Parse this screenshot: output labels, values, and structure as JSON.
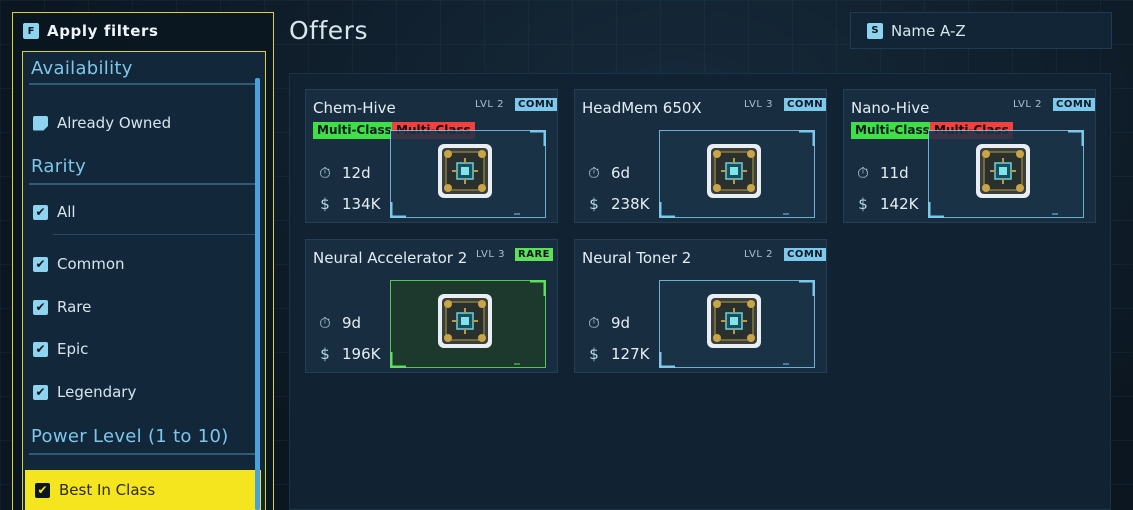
{
  "sidebar": {
    "key": "F",
    "title": "Apply filters",
    "sections": {
      "availability": "Availability",
      "rarity": "Rarity",
      "power": "Power Level (1 to 10)"
    },
    "items": {
      "owned": "Already Owned",
      "all": "All",
      "common": "Common",
      "rare": "Rare",
      "epic": "Epic",
      "legendary": "Legendary",
      "best": "Best In Class"
    },
    "check_glyph": "✔"
  },
  "header": {
    "title": "Offers",
    "sort_key": "S",
    "sort_label": "Name A-Z"
  },
  "colors": {
    "accent_yellow": "#f5e51e",
    "comn": "#7cc9ec",
    "rare": "#5fe05a",
    "tag_green": "#3ee046",
    "tag_red": "#f04040"
  },
  "icons": {
    "time": "stopwatch-icon",
    "price": "dollar-icon",
    "item": "chip-icon"
  },
  "cards": [
    {
      "name": "Chem-Hive",
      "level": "LVL 2",
      "rarity": "COMN",
      "tags": [
        "Multi-Class",
        "Multi-Class"
      ],
      "time": "12d",
      "price": "134K"
    },
    {
      "name": "HeadMem 650X",
      "level": "LVL 3",
      "rarity": "COMN",
      "tags": [],
      "time": "6d",
      "price": "238K"
    },
    {
      "name": "Nano-Hive",
      "level": "LVL 2",
      "rarity": "COMN",
      "tags": [
        "Multi-Class",
        "Multi-Class"
      ],
      "time": "11d",
      "price": "142K"
    },
    {
      "name": "Neural Accelerator 2",
      "level": "LVL 3",
      "rarity": "RARE",
      "tags": [],
      "time": "9d",
      "price": "196K"
    },
    {
      "name": "Neural Toner 2",
      "level": "LVL 2",
      "rarity": "COMN",
      "tags": [],
      "time": "9d",
      "price": "127K"
    }
  ]
}
